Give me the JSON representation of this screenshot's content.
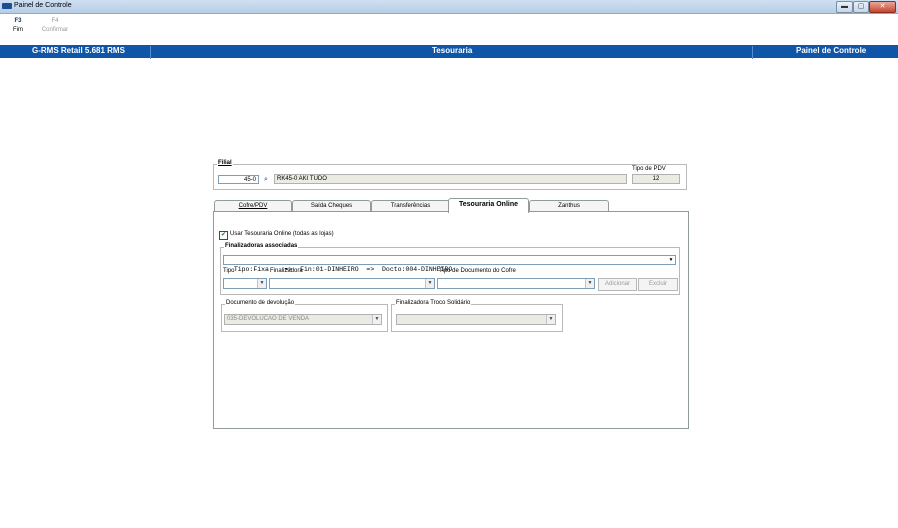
{
  "window": {
    "title": "Painel de Controle",
    "minimize": "▬",
    "maximize": "▢",
    "close": "✕"
  },
  "toolbar": {
    "f3_key": "F3",
    "f3_label": "Fim",
    "f4_key": "F4",
    "f4_label": "Confirmar"
  },
  "header": {
    "left": "G-RMS Retail 5.681 RMS",
    "center": "Tesouraria",
    "right": "Painel de Controle"
  },
  "filial": {
    "legend": "Filial",
    "code": "45-0",
    "name": "RK45-0 AKI TUDO",
    "pdv_label": "Tipo de PDV",
    "pdv_value": "12"
  },
  "tabs": [
    {
      "label": "Cofre/PDV"
    },
    {
      "label": "Saída Cheques"
    },
    {
      "label": "Transferências"
    },
    {
      "label": "Tesouraria Online"
    },
    {
      "label": "Zanthus"
    }
  ],
  "online": {
    "checkbox_label": "Usar Tesouraria Online (todas as lojas)",
    "checked": true,
    "fin_group_label": "Finalizadoras associadas",
    "fin_selected": "Tipo:Fixa    =>  Fin:01-DINHEIRO  =>  Docto:004-DINHEIRO",
    "col_tipo": "Tipo",
    "col_finalizadora": "Finalizadora",
    "col_tipo_doc": "Tipo de Documento do Cofre",
    "btn_adicionar": "Adicionar",
    "btn_excluir": "Excluir",
    "devolucao_label": "Documento de devolução",
    "devolucao_value": "035-DEVOLUCAO DE VENDA",
    "troco_label": "Finalizadora Troco Solidário",
    "troco_value": ""
  }
}
